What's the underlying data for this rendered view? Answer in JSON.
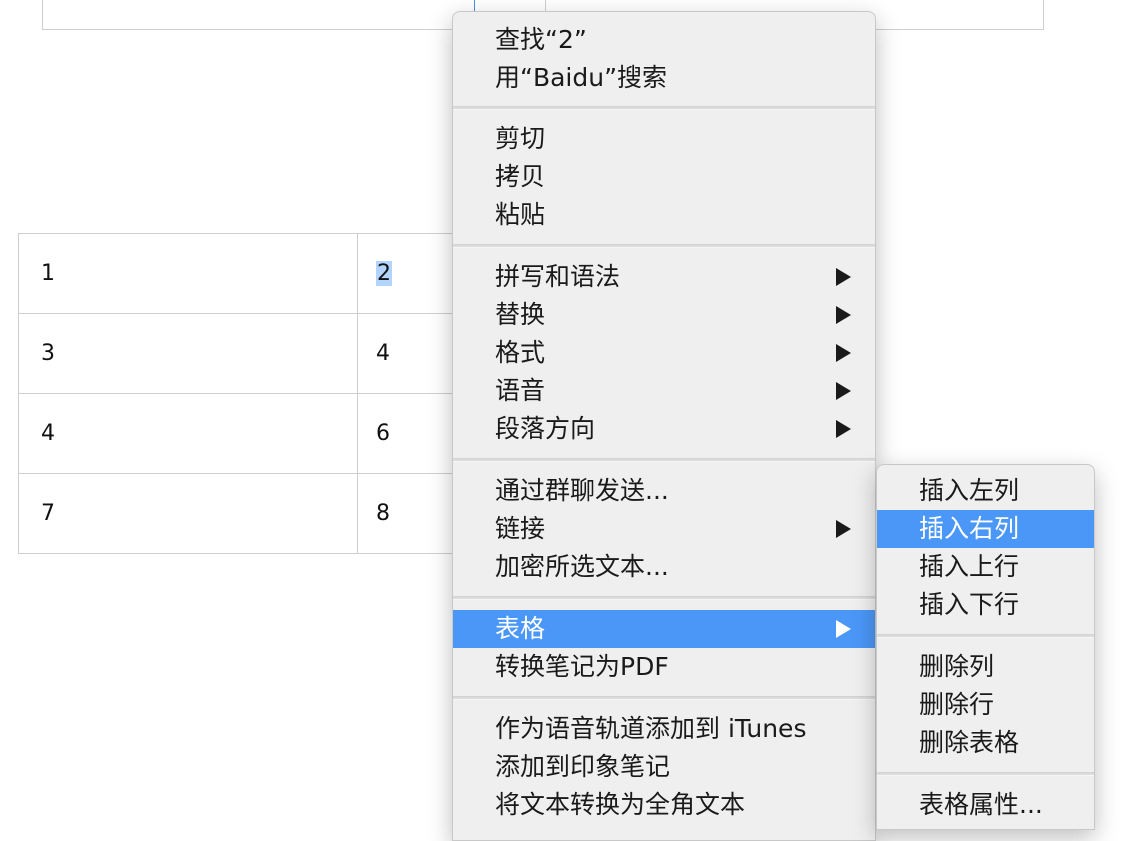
{
  "table": {
    "rows": [
      [
        "1",
        "2"
      ],
      [
        "3",
        "4"
      ],
      [
        "4",
        "6"
      ],
      [
        "7",
        "8"
      ]
    ]
  },
  "context_menu": {
    "find": "查找“2”",
    "search": "用“Baidu”搜索",
    "cut": "剪切",
    "copy": "拷贝",
    "paste": "粘贴",
    "spelling": "拼写和语法",
    "substitutions": "替换",
    "format": "格式",
    "speech": "语音",
    "paragraph_direction": "段落方向",
    "send_group_chat": "通过群聊发送...",
    "link": "链接",
    "encrypt": "加密所选文本...",
    "table": "表格",
    "to_pdf": "转换笔记为PDF",
    "add_itunes": "作为语音轨道添加到 iTunes",
    "add_evernote": "添加到印象笔记",
    "fullwidth": "将文本转换为全角文本"
  },
  "table_submenu": {
    "insert_left": "插入左列",
    "insert_right": "插入右列",
    "insert_above": "插入上行",
    "insert_below": "插入下行",
    "delete_column": "删除列",
    "delete_row": "删除行",
    "delete_table": "删除表格",
    "table_properties": "表格属性..."
  }
}
